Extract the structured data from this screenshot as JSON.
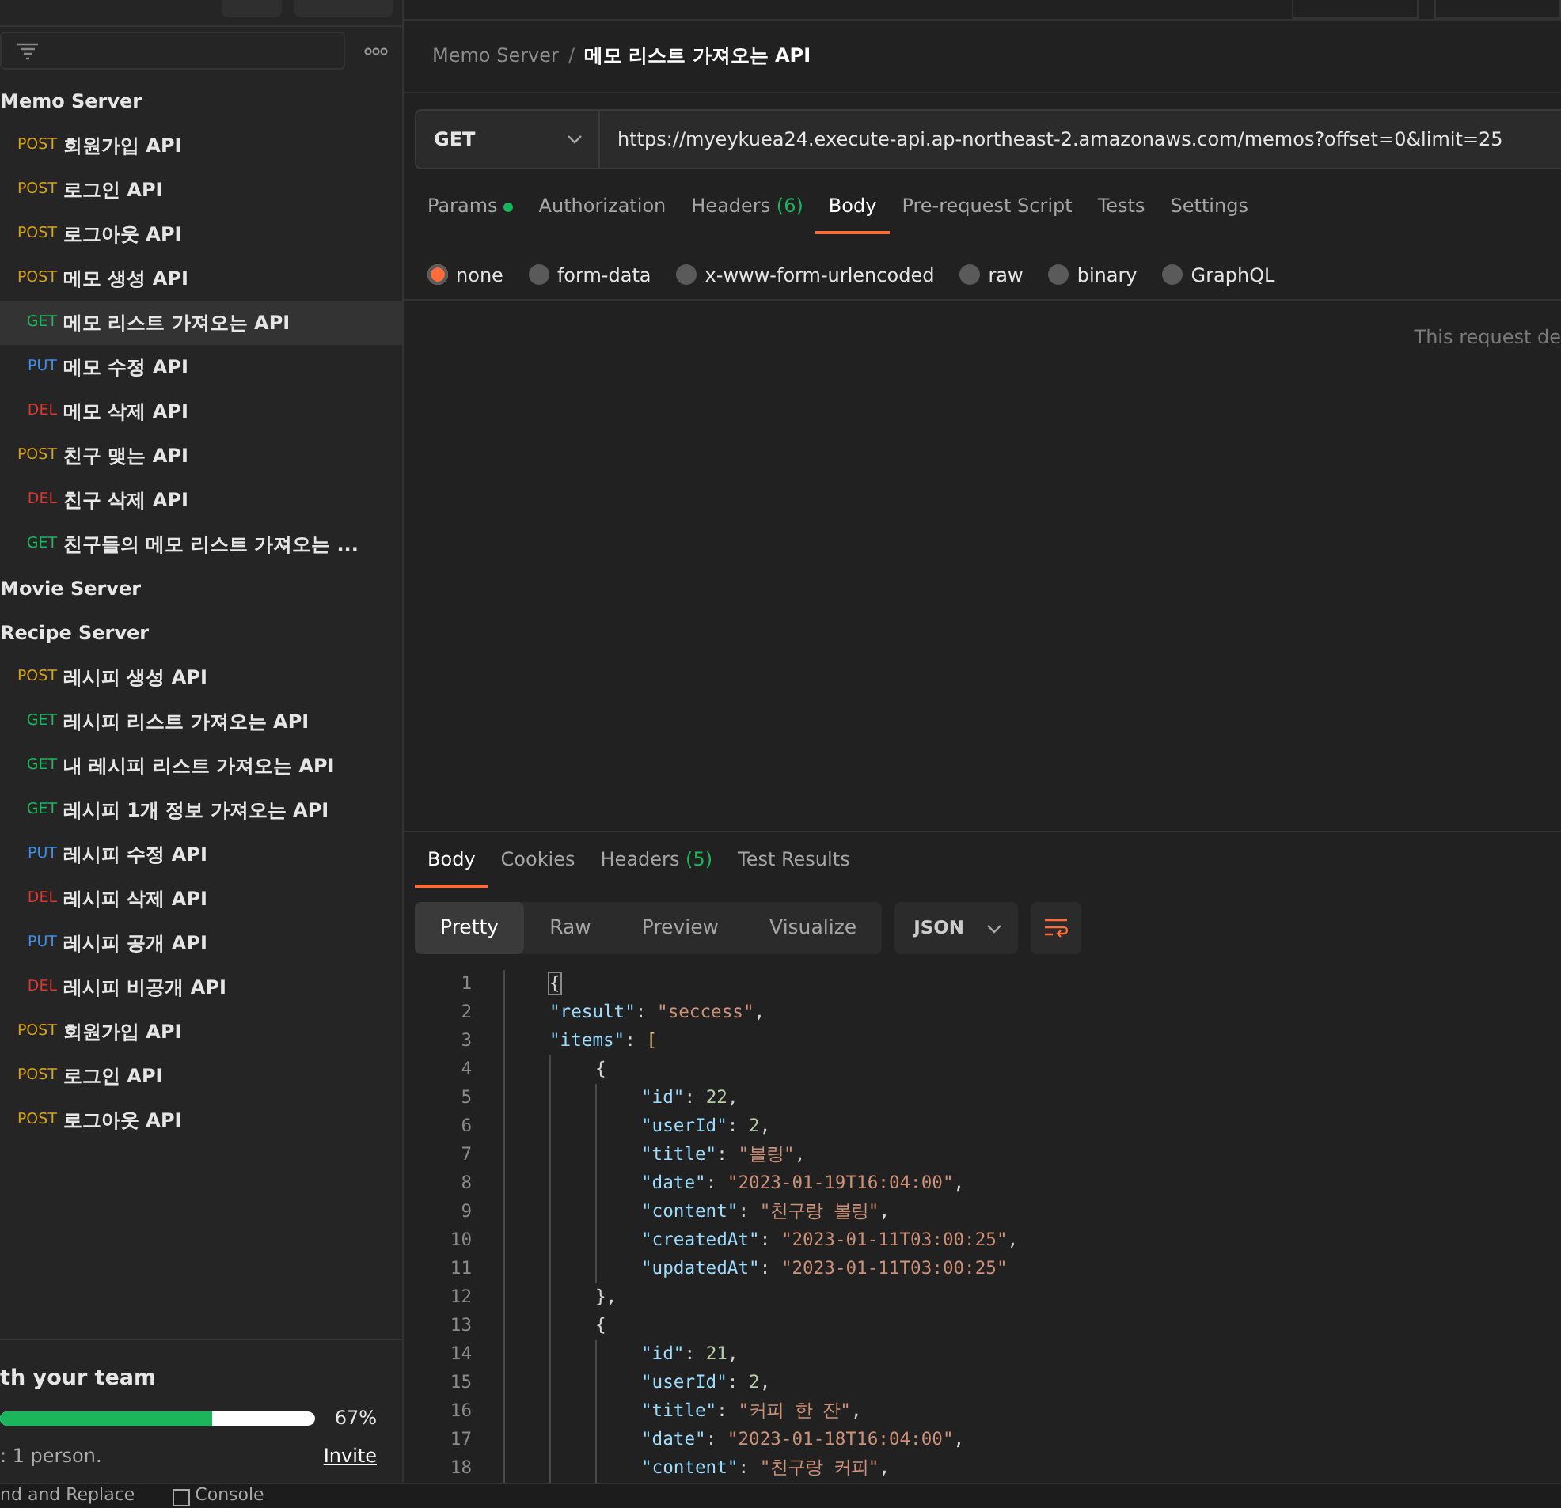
{
  "sidebar": {
    "folders": [
      {
        "name": "Memo Server",
        "children": [
          {
            "method": "POST",
            "name": "회원가입 API",
            "selected": false
          },
          {
            "method": "POST",
            "name": "로그인 API",
            "selected": false
          },
          {
            "method": "POST",
            "name": "로그아웃 API",
            "selected": false
          },
          {
            "method": "POST",
            "name": "메모 생성 API",
            "selected": false
          },
          {
            "method": "GET",
            "name": "메모 리스트 가져오는 API",
            "selected": true
          },
          {
            "method": "PUT",
            "name": "메모 수정 API",
            "selected": false
          },
          {
            "method": "DEL",
            "name": "메모 삭제 API",
            "selected": false
          },
          {
            "method": "POST",
            "name": "친구 맺는 API",
            "selected": false
          },
          {
            "method": "DEL",
            "name": "친구 삭제 API",
            "selected": false
          },
          {
            "method": "GET",
            "name": "친구들의 메모 리스트 가져오는 ...",
            "selected": false
          }
        ]
      },
      {
        "name": "Movie Server"
      },
      {
        "name": "Recipe Server",
        "children": [
          {
            "method": "POST",
            "name": "레시피 생성 API",
            "selected": false
          },
          {
            "method": "GET",
            "name": "레시피 리스트 가져오는 API",
            "selected": false
          },
          {
            "method": "GET",
            "name": "내 레시피 리스트 가져오는 API",
            "selected": false
          },
          {
            "method": "GET",
            "name": "레시피 1개 정보 가져오는 API",
            "selected": false
          },
          {
            "method": "PUT",
            "name": "레시피 수정 API",
            "selected": false
          },
          {
            "method": "DEL",
            "name": "레시피 삭제 API",
            "selected": false
          },
          {
            "method": "PUT",
            "name": "레시피 공개 API",
            "selected": false
          },
          {
            "method": "DEL",
            "name": "레시피 비공개 API",
            "selected": false
          },
          {
            "method": "POST",
            "name": "회원가입 API",
            "selected": false
          },
          {
            "method": "POST",
            "name": "로그인 API",
            "selected": false
          },
          {
            "method": "POST",
            "name": "로그아웃 API",
            "selected": false
          }
        ]
      }
    ],
    "team": {
      "title": "th your team",
      "level": 0.67,
      "percent": "67%",
      "note": ": 1 person.",
      "link": "Invite"
    }
  },
  "breadcrumb": {
    "parent": "Memo Server",
    "separator": "/",
    "current": "메모 리스트 가져오는 API"
  },
  "request": {
    "method": "GET",
    "url": "https://myeykuea24.execute-api.ap-northeast-2.amazonaws.com/memos?offset=0&limit=25"
  },
  "request_tabs": [
    {
      "label": "Params",
      "dot": true,
      "selected": false
    },
    {
      "label": "Authorization",
      "selected": false
    },
    {
      "label": "Headers",
      "count": "(6)",
      "selected": false
    },
    {
      "label": "Body",
      "selected": true
    },
    {
      "label": "Pre-request Script",
      "selected": false
    },
    {
      "label": "Tests",
      "selected": false
    },
    {
      "label": "Settings",
      "selected": false
    }
  ],
  "body_types": [
    {
      "label": "none",
      "selected": true
    },
    {
      "label": "form-data",
      "selected": false
    },
    {
      "label": "x-www-form-urlencoded",
      "selected": false
    },
    {
      "label": "raw",
      "selected": false
    },
    {
      "label": "binary",
      "selected": false
    },
    {
      "label": "GraphQL",
      "selected": false
    }
  ],
  "body_message": "This request de",
  "response_tabs": [
    {
      "label": "Body",
      "selected": true
    },
    {
      "label": "Cookies",
      "selected": false
    },
    {
      "label": "Headers",
      "count": "(5)",
      "selected": false
    },
    {
      "label": "Test Results",
      "selected": false
    }
  ],
  "view_modes": [
    {
      "label": "Pretty",
      "selected": true
    },
    {
      "label": "Raw",
      "selected": false
    },
    {
      "label": "Preview",
      "selected": false
    },
    {
      "label": "Visualize",
      "selected": false
    }
  ],
  "format": "JSON",
  "code_lines": [
    {
      "number": "1",
      "tokens": [
        {
          "kind": "brace",
          "text": "{"
        }
      ]
    },
    {
      "number": "2",
      "tokens": [
        {
          "kind": "key",
          "text": "    \"result\""
        },
        {
          "kind": "punct",
          "text": ": "
        },
        {
          "kind": "string",
          "text": "\"seccess\""
        },
        {
          "kind": "punct",
          "text": ","
        }
      ]
    },
    {
      "number": "3",
      "tokens": [
        {
          "kind": "key",
          "text": "    \"items\""
        },
        {
          "kind": "punct",
          "text": ": "
        },
        {
          "kind": "bracket",
          "text": "["
        }
      ]
    },
    {
      "number": "4",
      "tokens": [
        {
          "kind": "punct",
          "text": "        {"
        }
      ]
    },
    {
      "number": "5",
      "tokens": [
        {
          "kind": "key",
          "text": "            \"id\""
        },
        {
          "kind": "punct",
          "text": ": "
        },
        {
          "kind": "number",
          "text": "22"
        },
        {
          "kind": "punct",
          "text": ","
        }
      ]
    },
    {
      "number": "6",
      "tokens": [
        {
          "kind": "key",
          "text": "            \"userId\""
        },
        {
          "kind": "punct",
          "text": ": "
        },
        {
          "kind": "number",
          "text": "2"
        },
        {
          "kind": "punct",
          "text": ","
        }
      ]
    },
    {
      "number": "7",
      "tokens": [
        {
          "kind": "key",
          "text": "            \"title\""
        },
        {
          "kind": "punct",
          "text": ": "
        },
        {
          "kind": "string",
          "text": "\"볼링\""
        },
        {
          "kind": "punct",
          "text": ","
        }
      ]
    },
    {
      "number": "8",
      "tokens": [
        {
          "kind": "key",
          "text": "            \"date\""
        },
        {
          "kind": "punct",
          "text": ": "
        },
        {
          "kind": "string",
          "text": "\"2023-01-19T16:04:00\""
        },
        {
          "kind": "punct",
          "text": ","
        }
      ]
    },
    {
      "number": "9",
      "tokens": [
        {
          "kind": "key",
          "text": "            \"content\""
        },
        {
          "kind": "punct",
          "text": ": "
        },
        {
          "kind": "string",
          "text": "\"친구랑 볼링\""
        },
        {
          "kind": "punct",
          "text": ","
        }
      ]
    },
    {
      "number": "10",
      "tokens": [
        {
          "kind": "key",
          "text": "            \"createdAt\""
        },
        {
          "kind": "punct",
          "text": ": "
        },
        {
          "kind": "string",
          "text": "\"2023-01-11T03:00:25\""
        },
        {
          "kind": "punct",
          "text": ","
        }
      ]
    },
    {
      "number": "11",
      "tokens": [
        {
          "kind": "key",
          "text": "            \"updatedAt\""
        },
        {
          "kind": "punct",
          "text": ": "
        },
        {
          "kind": "string",
          "text": "\"2023-01-11T03:00:25\""
        }
      ]
    },
    {
      "number": "12",
      "tokens": [
        {
          "kind": "punct",
          "text": "        },"
        }
      ]
    },
    {
      "number": "13",
      "tokens": [
        {
          "kind": "punct",
          "text": "        {"
        }
      ]
    },
    {
      "number": "14",
      "tokens": [
        {
          "kind": "key",
          "text": "            \"id\""
        },
        {
          "kind": "punct",
          "text": ": "
        },
        {
          "kind": "number",
          "text": "21"
        },
        {
          "kind": "punct",
          "text": ","
        }
      ]
    },
    {
      "number": "15",
      "tokens": [
        {
          "kind": "key",
          "text": "            \"userId\""
        },
        {
          "kind": "punct",
          "text": ": "
        },
        {
          "kind": "number",
          "text": "2"
        },
        {
          "kind": "punct",
          "text": ","
        }
      ]
    },
    {
      "number": "16",
      "tokens": [
        {
          "kind": "key",
          "text": "            \"title\""
        },
        {
          "kind": "punct",
          "text": ": "
        },
        {
          "kind": "string",
          "text": "\"커피 한 잔\""
        },
        {
          "kind": "punct",
          "text": ","
        }
      ]
    },
    {
      "number": "17",
      "tokens": [
        {
          "kind": "key",
          "text": "            \"date\""
        },
        {
          "kind": "punct",
          "text": ": "
        },
        {
          "kind": "string",
          "text": "\"2023-01-18T16:04:00\""
        },
        {
          "kind": "punct",
          "text": ","
        }
      ]
    },
    {
      "number": "18",
      "tokens": [
        {
          "kind": "key",
          "text": "            \"content\""
        },
        {
          "kind": "punct",
          "text": ": "
        },
        {
          "kind": "string",
          "text": "\"친구랑 커피\""
        },
        {
          "kind": "punct",
          "text": ","
        }
      ]
    }
  ],
  "status_bar": [
    "nd and Replace",
    "Console"
  ]
}
